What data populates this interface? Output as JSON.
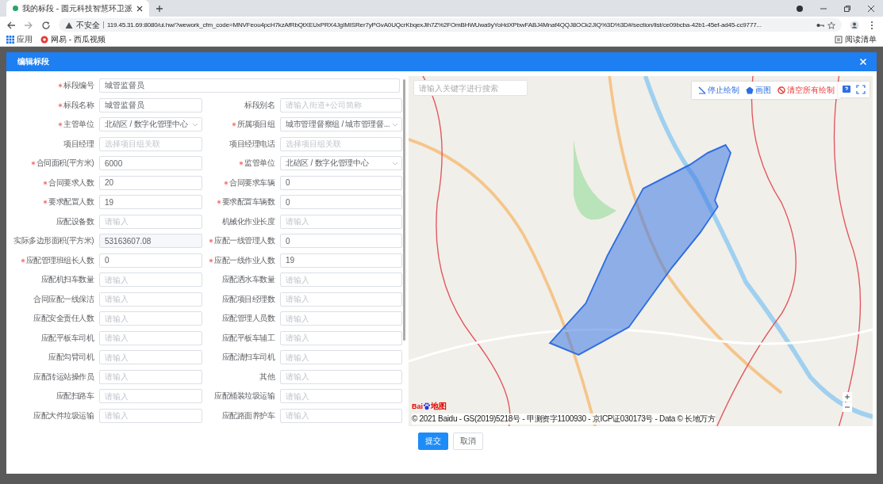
{
  "browser": {
    "tab_title": "我的标段 - 圆元科技智慧环卫派",
    "url_security": "不安全",
    "url": "119.45.31.69:8080/ui.hw/?wework_cfm_code=MNVFeou4pcH7kzAfRbQtXEUxPRX4JgIMISRer7yPGvA0UQcrKbqexJih7Z%2FOmBHWUwa9yYoHdXPbwFABJ4Mnaf4QQJ8OCk2JIQ%3D%3D#/section/list/ce09bcba-42b1-45ef-ad45-cc9777...",
    "bookmarks": [
      {
        "label": "应用",
        "kind": "apps"
      },
      {
        "label": "网易 - 西瓜视频",
        "kind": "site"
      }
    ],
    "reading_list": "阅读清单"
  },
  "modal": {
    "title": "编辑标段",
    "form": {
      "rows": [
        {
          "fields": [
            {
              "label": "标段编号",
              "required": true,
              "kind": "input",
              "value": "城管监督员"
            }
          ]
        },
        {
          "fields": [
            {
              "label": "标段名称",
              "required": true,
              "kind": "input",
              "value": "城管监督员"
            },
            {
              "label": "标段别名",
              "required": false,
              "kind": "input",
              "placeholder": "请输入街道+公司简称"
            }
          ]
        },
        {
          "fields": [
            {
              "label": "主管单位",
              "required": true,
              "kind": "select",
              "value": "北碚区 / 数字化管理中心"
            },
            {
              "label": "所属项目组",
              "required": true,
              "kind": "select",
              "value": "城市管理督察组 / 城市管理督..."
            }
          ]
        },
        {
          "fields": [
            {
              "label": "项目经理",
              "required": false,
              "kind": "input",
              "placeholder": "选择项目组关联"
            },
            {
              "label": "项目经理电话",
              "required": false,
              "kind": "input",
              "placeholder": "选择项目组关联"
            }
          ]
        },
        {
          "fields": [
            {
              "label": "合同面积(平方米)",
              "required": true,
              "kind": "input",
              "value": "6000"
            },
            {
              "label": "监管单位",
              "required": true,
              "kind": "select",
              "value": "北碚区 / 数字化管理中心"
            }
          ]
        },
        {
          "fields": [
            {
              "label": "合同要求人数",
              "required": true,
              "kind": "input",
              "value": "20"
            },
            {
              "label": "合同要求车辆",
              "required": true,
              "kind": "input",
              "value": "0"
            }
          ]
        },
        {
          "fields": [
            {
              "label": "要求配置人数",
              "required": true,
              "kind": "input",
              "value": "19"
            },
            {
              "label": "要求配置车辆数",
              "required": true,
              "kind": "input",
              "value": "0"
            }
          ]
        },
        {
          "fields": [
            {
              "label": "应配设备数",
              "required": false,
              "kind": "input",
              "placeholder": "请输入"
            },
            {
              "label": "机械化作业长度",
              "required": false,
              "kind": "input",
              "placeholder": "请输入"
            }
          ]
        },
        {
          "fields": [
            {
              "label": "实际多边形面积(平方米)",
              "required": false,
              "kind": "disabled",
              "value": "53163607.08"
            },
            {
              "label": "应配一线管理人数",
              "required": true,
              "kind": "input",
              "value": "0"
            }
          ]
        },
        {
          "fields": [
            {
              "label": "应配管理班组长人数",
              "required": true,
              "kind": "input",
              "value": "0"
            },
            {
              "label": "应配一线作业人数",
              "required": true,
              "kind": "input",
              "value": "19"
            }
          ]
        },
        {
          "fields": [
            {
              "label": "应配机扫车数量",
              "required": false,
              "kind": "input",
              "placeholder": "请输入"
            },
            {
              "label": "应配洒水车数量",
              "required": false,
              "kind": "input",
              "placeholder": "请输入"
            }
          ]
        },
        {
          "fields": [
            {
              "label": "合同应配一线保洁",
              "required": false,
              "kind": "input",
              "placeholder": "请输入"
            },
            {
              "label": "应配项目经理数",
              "required": false,
              "kind": "input",
              "placeholder": "请输入"
            }
          ]
        },
        {
          "fields": [
            {
              "label": "应配安全责任人数",
              "required": false,
              "kind": "input",
              "placeholder": "请输入"
            },
            {
              "label": "应配管理人员数",
              "required": false,
              "kind": "input",
              "placeholder": "请输入"
            }
          ]
        },
        {
          "fields": [
            {
              "label": "应配平板车司机",
              "required": false,
              "kind": "input",
              "placeholder": "请输入"
            },
            {
              "label": "应配平板车辅工",
              "required": false,
              "kind": "input",
              "placeholder": "请输入"
            }
          ]
        },
        {
          "fields": [
            {
              "label": "应配勾臂司机",
              "required": false,
              "kind": "input",
              "placeholder": "请输入"
            },
            {
              "label": "应配清扫车司机",
              "required": false,
              "kind": "input",
              "placeholder": "请输入"
            }
          ]
        },
        {
          "fields": [
            {
              "label": "应配转运站操作员",
              "required": false,
              "kind": "input",
              "placeholder": "请输入"
            },
            {
              "label": "其他",
              "required": false,
              "kind": "input",
              "placeholder": "请输入"
            }
          ]
        },
        {
          "fields": [
            {
              "label": "应配扫路车",
              "required": false,
              "kind": "input",
              "placeholder": "请输入"
            },
            {
              "label": "应配桶装垃圾运输",
              "required": false,
              "kind": "input",
              "placeholder": "请输入"
            }
          ]
        },
        {
          "fields": [
            {
              "label": "应配大件垃圾运输",
              "required": false,
              "kind": "input",
              "placeholder": "请输入"
            },
            {
              "label": "应配路面养护车",
              "required": false,
              "kind": "input",
              "placeholder": "请输入"
            }
          ]
        }
      ]
    },
    "map": {
      "search": {
        "placeholder": "请输入关键字进行搜索"
      },
      "tools": [
        {
          "label": "停止绘制",
          "kind": "stop"
        },
        {
          "label": "画图",
          "kind": "polygon"
        },
        {
          "label": "清空所有绘制",
          "kind": "clear"
        }
      ],
      "logo": {
        "text": "Bai",
        "suffix": "地图"
      },
      "copyright": "© 2021 Baidu - GS(2019)5218号 - 甲测资字1100930 - 京ICP证030173号 - Data © 长地万方"
    },
    "buttons": [
      {
        "label": "提交",
        "kind": "primary"
      },
      {
        "label": "取消",
        "kind": "default"
      }
    ]
  }
}
